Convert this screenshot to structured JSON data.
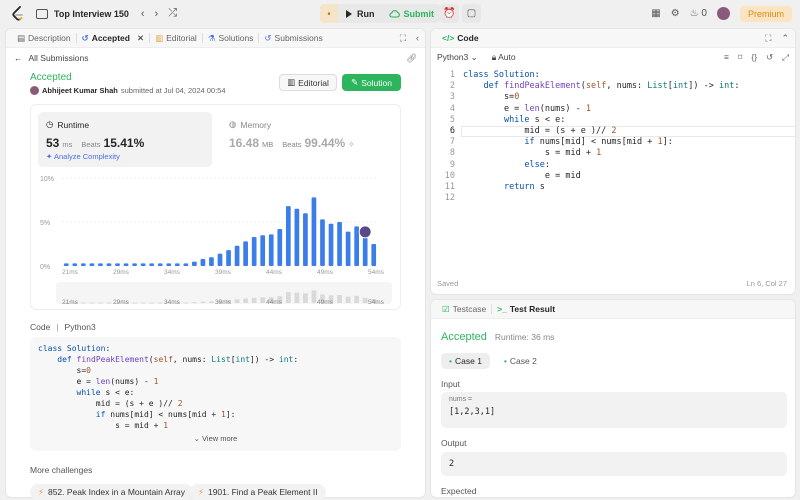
{
  "topbar": {
    "problem_list": "Top Interview 150",
    "run": "Run",
    "submit": "Submit",
    "streak": "0",
    "premium": "Premium",
    "prev": "‹",
    "next": "›",
    "shuffle": "⤮"
  },
  "left_tabs": [
    {
      "label": "Description",
      "icon": "doc-icon"
    },
    {
      "label": "Accepted",
      "icon": "history-icon"
    },
    {
      "label": "Editorial",
      "icon": "book-icon"
    },
    {
      "label": "Solutions",
      "icon": "flask-icon"
    },
    {
      "label": "Submissions",
      "icon": "history-icon"
    }
  ],
  "submission": {
    "back": "All Submissions",
    "status": "Accepted",
    "author": "Abhijeet Kumar Shah",
    "submitted": "submitted at Jul 04, 2024 00:54",
    "editorial_btn": "Editorial",
    "solution_btn": "Solution"
  },
  "runtime": {
    "label": "Runtime",
    "value": "53",
    "unit": "ms",
    "beats_label": "Beats",
    "beats": "15.41%",
    "analyze": "Analyze Complexity"
  },
  "memory": {
    "label": "Memory",
    "value": "16.48",
    "unit": "MB",
    "beats_label": "Beats",
    "beats": "99.44%"
  },
  "chart_data": {
    "type": "bar",
    "ylabels": [
      "10%",
      "5%",
      "0%"
    ],
    "ylim": [
      0,
      10
    ],
    "x_ticks": [
      "21ms",
      "29ms",
      "34ms",
      "39ms",
      "44ms",
      "49ms",
      "54ms"
    ],
    "values": [
      0.3,
      0.3,
      0.3,
      0.3,
      0.3,
      0.3,
      0.3,
      0.3,
      0.3,
      0.3,
      0.3,
      0.3,
      0.3,
      0.3,
      0.3,
      0.5,
      0.8,
      1.0,
      1.4,
      1.8,
      2.3,
      2.8,
      3.3,
      3.5,
      3.6,
      4.2,
      6.8,
      6.5,
      6.0,
      7.8,
      5.3,
      4.8,
      5.0,
      3.9,
      4.5,
      3.2,
      2.5
    ],
    "highlight_index": 35,
    "brush_ticks": [
      "21ms",
      "29ms",
      "34ms",
      "39ms",
      "44ms",
      "49ms",
      "54ms"
    ]
  },
  "code_preview": {
    "label": "Code",
    "lang": "Python3",
    "view_more": "View more",
    "lines": [
      "class Solution:",
      "    def findPeakElement(self, nums: List[int]) -> int:",
      "        s=0",
      "        e = len(nums) - 1",
      "        while s < e:",
      "            mid = (s + e )// 2",
      "            if nums[mid] < nums[mid + 1]:",
      "                s = mid + 1"
    ]
  },
  "more": {
    "title": "More challenges",
    "items": [
      "852. Peak Index in a Mountain Array",
      "1901. Find a Peak Element II"
    ]
  },
  "code_panel": {
    "title": "Code",
    "lang": "Python3",
    "mode": "Auto",
    "saved": "Saved",
    "position": "Ln 6, Col 27",
    "lines": [
      "class Solution:",
      "    def findPeakElement(self, nums: List[int]) -> int:",
      "        s=0",
      "        e = len(nums) - 1",
      "        while s < e:",
      "            mid = (s + e )// 2",
      "            if nums[mid] < nums[mid + 1]:",
      "                s = mid + 1",
      "            else:",
      "                e = mid",
      "        return s",
      ""
    ]
  },
  "result_panel": {
    "tab_testcase": "Testcase",
    "tab_result": "Test Result",
    "status": "Accepted",
    "runtime": "Runtime: 36 ms",
    "case1": "Case 1",
    "case2": "Case 2",
    "input_label": "Input",
    "nums_label": "nums =",
    "nums_value": "[1,2,3,1]",
    "output_label": "Output",
    "output_value": "2",
    "expected_label": "Expected"
  }
}
